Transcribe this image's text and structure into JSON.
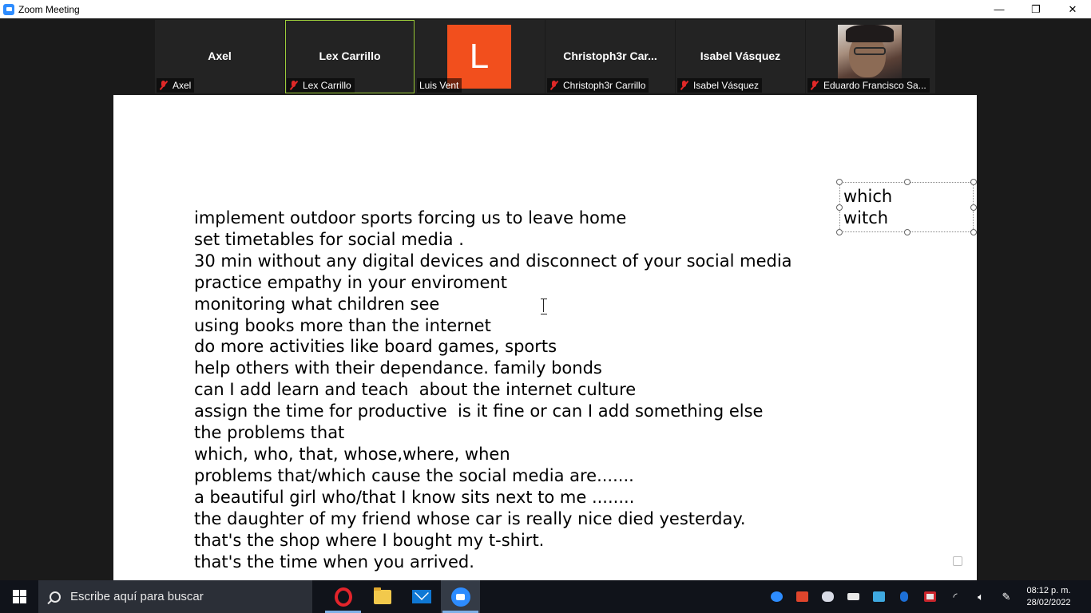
{
  "window": {
    "title": "Zoom Meeting",
    "controls": {
      "minimize": "—",
      "restore": "❐",
      "close": "✕"
    }
  },
  "participants": [
    {
      "name": "Axel",
      "label": "Axel",
      "muted": true,
      "display": "name"
    },
    {
      "name": "Lex Carrillo",
      "label": "Lex Carrillo",
      "muted": true,
      "display": "name",
      "active_speaker": true
    },
    {
      "name": "",
      "label": "Luis Vent",
      "muted": false,
      "display": "avatar",
      "avatar_letter": "L",
      "avatar_color": "#f24f1d"
    },
    {
      "name": "Christoph3r  Car...",
      "label": "Christoph3r Carrillo",
      "muted": true,
      "display": "name"
    },
    {
      "name": "Isabel Vásquez",
      "label": "Isabel Vásquez",
      "muted": true,
      "display": "name"
    },
    {
      "name": "",
      "label": "Eduardo Francisco Sa...",
      "muted": true,
      "display": "video"
    }
  ],
  "shared_document": {
    "lines": [
      "implement outdoor sports forcing us to leave home",
      "set timetables for social media .",
      "30 min without any digital devices and disconnect of your social media",
      "practice empathy in your enviroment",
      "monitoring what children see",
      "using books more than the internet",
      "do more activities like board games, sports",
      "help others with their dependance. family bonds",
      "can I add learn and teach  about the internet culture",
      "assign the time for productive  is it fine or can I add something else",
      "the problems that",
      "which, who, that, whose,where, when",
      "problems that/which cause the social media are.......",
      "a beautiful girl who/that I know sits next to me ........",
      "the daughter of my friend whose car is really nice died yesterday.",
      "that's the shop where I bought my t-shirt.",
      "that's the time when you arrived."
    ],
    "textbox": {
      "line1": "which",
      "line2": "witch"
    }
  },
  "taskbar": {
    "search_placeholder": "Escribe aquí para buscar",
    "apps": [
      "opera-icon",
      "file-explorer-icon",
      "mail-icon",
      "zoom-icon"
    ],
    "tray_icons": [
      "zoom-tray-icon",
      "calendar-icon",
      "discord-icon",
      "battery-icon",
      "network-app-icon",
      "bluetooth-icon",
      "security-icon",
      "wifi-icon",
      "volume-icon",
      "pen-icon"
    ],
    "time": "08:12 p. m.",
    "date": "28/02/2022"
  },
  "colors": {
    "accent": "#2d8cff",
    "muted_mic": "#e02828",
    "active_speaker_border": "#9ccc3a"
  }
}
